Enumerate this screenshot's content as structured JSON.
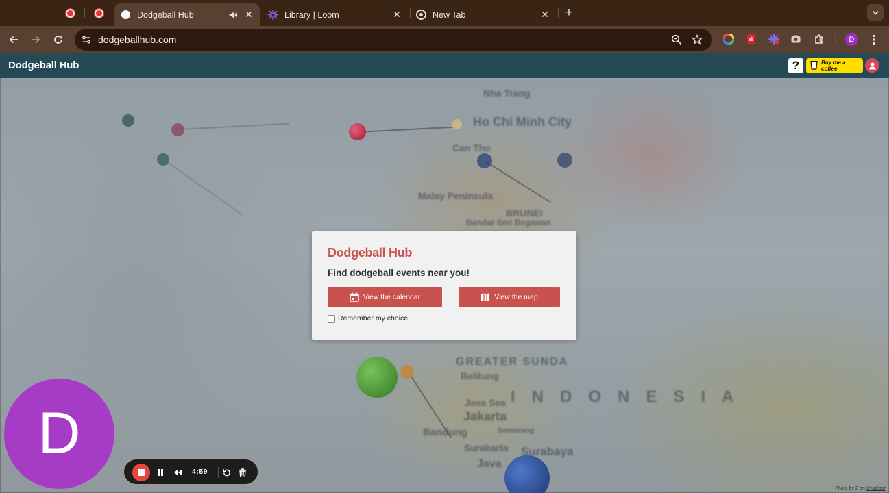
{
  "browser": {
    "tabs": [
      {
        "title": "Dodgeball Hub",
        "active": true
      },
      {
        "title": "Library | Loom",
        "active": false
      },
      {
        "title": "New Tab",
        "active": false
      }
    ],
    "url": "dodgeballhub.com",
    "profile_initial": "D"
  },
  "site": {
    "logo": "Dodgeball Hub",
    "help_label": "?",
    "coffee_label": "Buy me a coffee"
  },
  "modal": {
    "logo": "Dodgeball Hub",
    "tagline": "Find dodgeball events near you!",
    "calendar_label": "View the calendar",
    "map_label": "View the map",
    "remember_label": "Remember my choice"
  },
  "background": {
    "map_labels": [
      "Nha Trang",
      "Ho Chi Minh City",
      "Can Tho",
      "Malay Peninsula",
      "Bandar Seri Begawan",
      "BRUNEI",
      "GREATER SUNDA",
      "Belitung",
      "Java Sea",
      "Jakarta",
      "Bandung",
      "Semarang",
      "Surakarta",
      "Surabaya",
      "Java",
      "INDONESIA"
    ],
    "credit_prefix": "Photo by Z on",
    "credit_link": "Unsplash"
  },
  "loom": {
    "avatar_initial": "D",
    "timer": "4:59"
  },
  "colors": {
    "brand_red": "#c9524f",
    "header_teal": "#264a55",
    "coffee_yellow": "#ffdd00",
    "loom_purple": "#a63bc6",
    "record_red": "#e64640"
  }
}
